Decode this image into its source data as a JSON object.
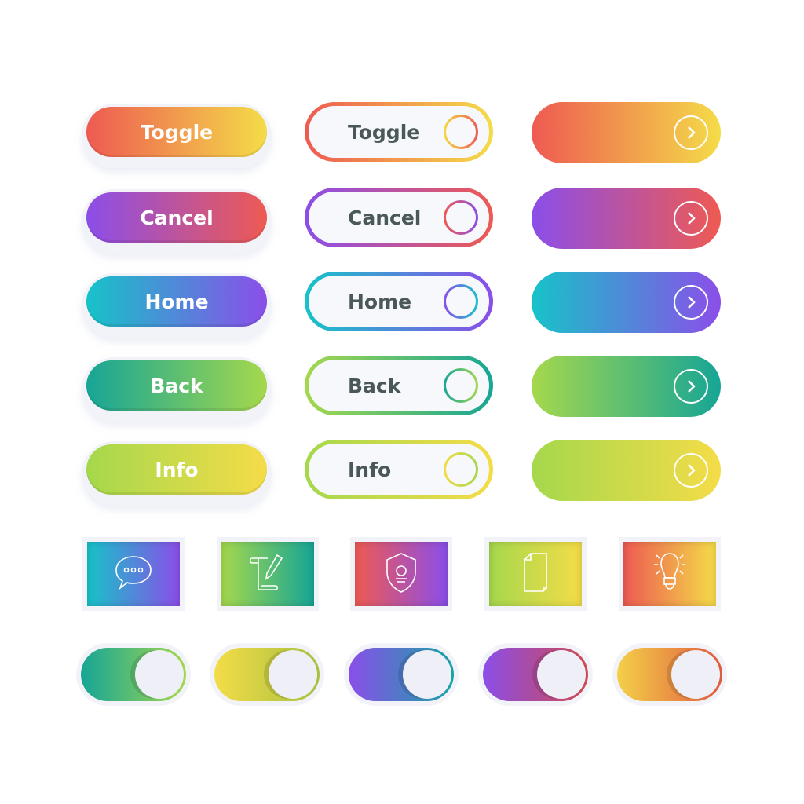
{
  "colors": {
    "red": "#ee5a52",
    "yellow": "#f4dc48",
    "purple": "#8b4ee9",
    "teal": "#16c3c8",
    "deep_teal": "#16a596",
    "lime": "#a5d84c"
  },
  "solid_buttons": [
    {
      "label": "Toggle",
      "from": "#ee5a52",
      "to": "#f4dc48"
    },
    {
      "label": "Cancel",
      "from": "#8b4ee9",
      "to": "#ee5a52"
    },
    {
      "label": "Home",
      "from": "#16c3c8",
      "to": "#8b4ee9"
    },
    {
      "label": "Back",
      "from": "#16a596",
      "to": "#a5d84c"
    },
    {
      "label": "Info",
      "from": "#a5d84c",
      "to": "#f4dc48"
    }
  ],
  "outline_buttons": [
    {
      "label": "Toggle",
      "from": "#ee5a52",
      "to": "#f4dc48"
    },
    {
      "label": "Cancel",
      "from": "#8b4ee9",
      "to": "#ee5a52"
    },
    {
      "label": "Home",
      "from": "#16c3c8",
      "to": "#8b4ee9"
    },
    {
      "label": "Back",
      "from": "#a5d84c",
      "to": "#16a596"
    },
    {
      "label": "Info",
      "from": "#a5d84c",
      "to": "#f4dc48"
    }
  ],
  "arrow_buttons": [
    {
      "icon": "chevron-right-circle-icon",
      "from": "#ee5a52",
      "to": "#f4dc48"
    },
    {
      "icon": "chevron-right-circle-icon",
      "from": "#8b4ee9",
      "to": "#ee5a52"
    },
    {
      "icon": "chevron-right-circle-icon",
      "from": "#16c3c8",
      "to": "#8b4ee9"
    },
    {
      "icon": "chevron-right-circle-icon",
      "from": "#a5d84c",
      "to": "#16a596"
    },
    {
      "icon": "chevron-right-circle-icon",
      "from": "#a5d84c",
      "to": "#f4dc48"
    }
  ],
  "icon_buttons": [
    {
      "icon": "chat-bubble-icon",
      "from": "#16c3c8",
      "to": "#8b4ee9"
    },
    {
      "icon": "edit-scroll-icon",
      "from": "#a5d84c",
      "to": "#16a596"
    },
    {
      "icon": "shield-icon",
      "from": "#ee5a52",
      "to": "#8b4ee9"
    },
    {
      "icon": "document-icon",
      "from": "#a5d84c",
      "to": "#f4dc48"
    },
    {
      "icon": "lightbulb-icon",
      "from": "#ee5a52",
      "to": "#f4dc48"
    }
  ],
  "toggles": [
    {
      "state": "on",
      "from": "#16a596",
      "to": "#a5d84c"
    },
    {
      "state": "on",
      "from": "#f4dc48",
      "to": "#a5c040"
    },
    {
      "state": "on",
      "from": "#8b4ee9",
      "to": "#16a5a5"
    },
    {
      "state": "on",
      "from": "#8b4ee9",
      "to": "#d04a50"
    },
    {
      "state": "on",
      "from": "#f4d048",
      "to": "#e05a40"
    }
  ]
}
